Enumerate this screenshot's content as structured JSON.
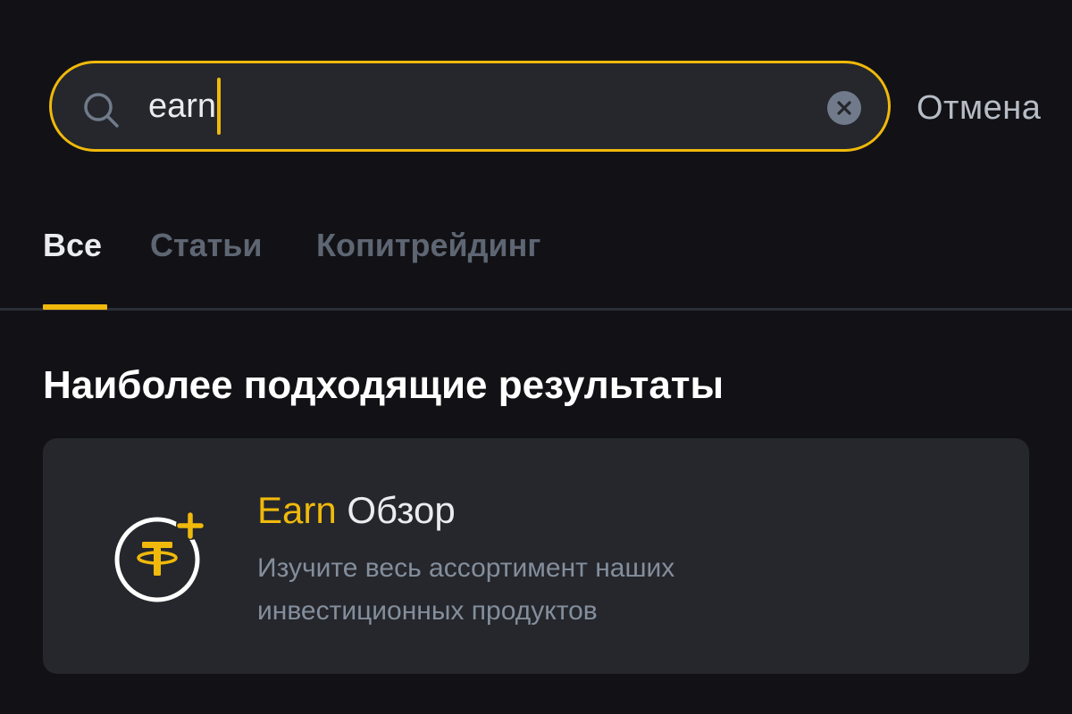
{
  "search": {
    "query": "earn",
    "cancel_label": "Отмена"
  },
  "tabs": [
    {
      "label": "Все",
      "active": true
    },
    {
      "label": "Статьи",
      "active": false
    },
    {
      "label": "Копитрейдинг",
      "active": false
    }
  ],
  "section": {
    "title": "Наиболее подходящие результаты"
  },
  "result": {
    "title_highlight": "Earn",
    "title_rest": "Обзор",
    "description": "Изучите весь ассортимент наших инвестиционных продуктов",
    "icon": "tether-plus-icon"
  },
  "colors": {
    "accent": "#f0b90b",
    "background": "#121216",
    "card": "#25272c",
    "text_primary": "#eaecef",
    "text_muted": "#848e9c",
    "tab_inactive": "#5e6673"
  }
}
